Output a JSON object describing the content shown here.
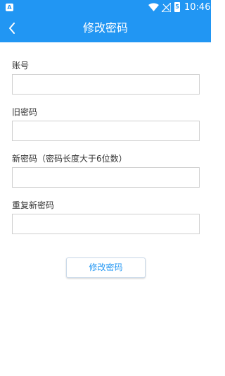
{
  "status_bar": {
    "app_badge": "A",
    "battery_badge": "5",
    "time": "10:46",
    "icons": [
      "app-notification-icon",
      "wifi-icon",
      "no-signal-icon",
      "battery-icon"
    ]
  },
  "header": {
    "title": "修改密码",
    "back_icon": "chevron-left-icon",
    "background_color": "#2196f3"
  },
  "form": {
    "account": {
      "label": "账号",
      "value": "",
      "placeholder": ""
    },
    "old_password": {
      "label": "旧密码",
      "value": "",
      "placeholder": ""
    },
    "new_password": {
      "label": "新密码（密码长度大于6位数）",
      "value": "",
      "placeholder": ""
    },
    "repeat_password": {
      "label": "重复新密码",
      "value": "",
      "placeholder": ""
    }
  },
  "submit_button": {
    "label": "修改密码"
  },
  "colors": {
    "accent": "#2196f3",
    "field_border": "#cfcfcf",
    "background": "#ffffff"
  }
}
